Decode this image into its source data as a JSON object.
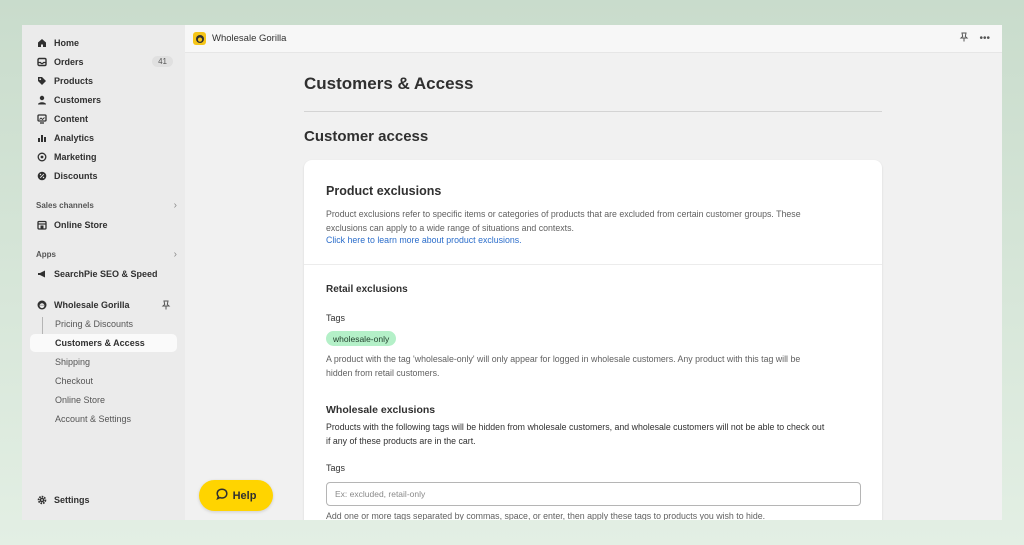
{
  "sidebar": {
    "items": [
      {
        "label": "Home",
        "icon": "home-icon"
      },
      {
        "label": "Orders",
        "icon": "inbox-icon",
        "badge": "41"
      },
      {
        "label": "Products",
        "icon": "tag-icon"
      },
      {
        "label": "Customers",
        "icon": "person-icon"
      },
      {
        "label": "Content",
        "icon": "content-icon"
      },
      {
        "label": "Analytics",
        "icon": "bar-chart-icon"
      },
      {
        "label": "Marketing",
        "icon": "target-icon"
      },
      {
        "label": "Discounts",
        "icon": "discount-icon"
      }
    ],
    "sales_channels_label": "Sales channels",
    "online_store_label": "Online Store",
    "apps_label": "Apps",
    "searchpie_label": "SearchPie SEO & Speed",
    "wholesale_label": "Wholesale Gorilla",
    "sub_items": [
      "Pricing & Discounts",
      "Customers & Access",
      "Shipping",
      "Checkout",
      "Online Store",
      "Account & Settings"
    ],
    "active_sub": "Customers & Access",
    "settings_label": "Settings"
  },
  "topbar": {
    "app_name": "Wholesale Gorilla",
    "more_label": "•••"
  },
  "main": {
    "page_title": "Customers & Access",
    "section_title": "Customer access",
    "card": {
      "heading": "Product exclusions",
      "description": "Product exclusions refer to specific items or categories of products that are excluded from certain customer groups. These exclusions can apply to a wide range of situations and contexts.",
      "link": "Click here to learn more about product exclusions.",
      "retail": {
        "heading": "Retail exclusions",
        "tags_label": "Tags",
        "tag": "wholesale-only",
        "help": "A product with the tag 'wholesale-only' will only appear for logged in wholesale customers. Any product with this tag will be hidden from retail customers."
      },
      "wholesale": {
        "heading": "Wholesale exclusions",
        "description": "Products with the following tags will be hidden from wholesale customers, and wholesale customers will not be able to check out if any of these products are in the cart.",
        "tags_label": "Tags",
        "placeholder": "Ex: excluded, retail-only",
        "help": "Add one or more tags separated by commas, space, or enter, then apply these tags to products you wish to hide."
      }
    }
  },
  "help_button": {
    "label": "Help"
  },
  "colors": {
    "accent_yellow": "#ffd400",
    "tag_green": "#b4f0c8",
    "link_blue": "#2c6ecb"
  }
}
